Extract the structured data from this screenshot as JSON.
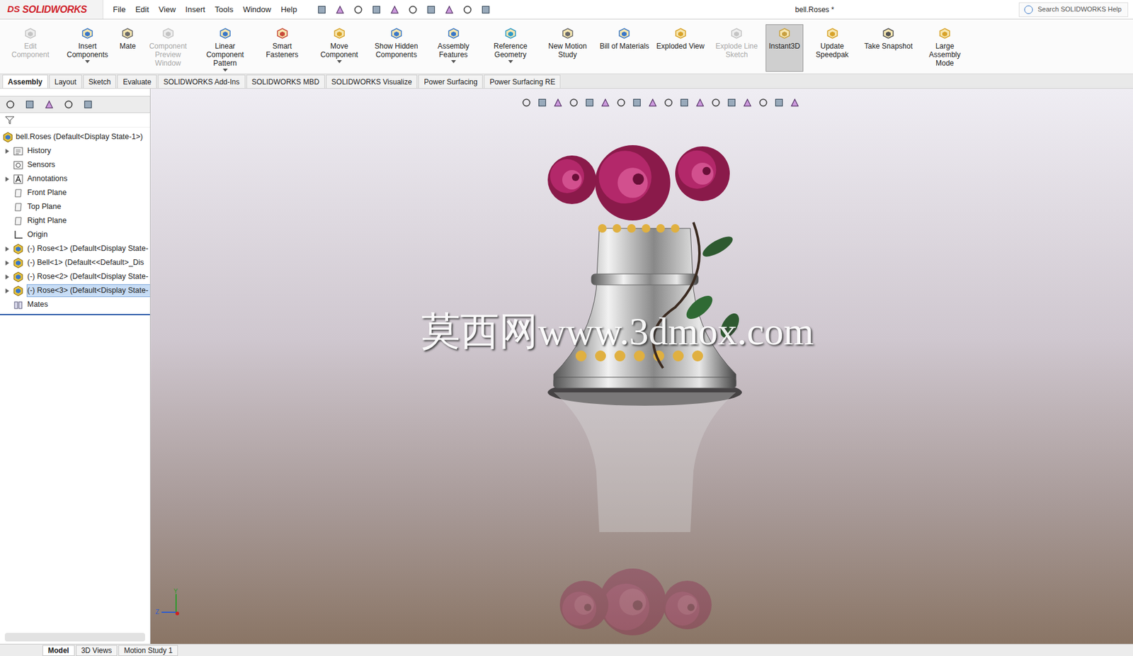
{
  "window": {
    "title": "bell.Roses *"
  },
  "app": {
    "logo_prefix": "DS",
    "logo": "SOLIDWORKS"
  },
  "menu": [
    "File",
    "Edit",
    "View",
    "Insert",
    "Tools",
    "Window",
    "Help"
  ],
  "search": {
    "placeholder": "Search SOLIDWORKS Help"
  },
  "ribbon": [
    {
      "label": "Edit Component",
      "disabled": true,
      "selected": false,
      "dropdown": false
    },
    {
      "label": "Insert Components",
      "disabled": false,
      "selected": false,
      "dropdown": true
    },
    {
      "label": "Mate",
      "disabled": false,
      "selected": false,
      "dropdown": false
    },
    {
      "label": "Component Preview Window",
      "disabled": true,
      "selected": false,
      "dropdown": false
    },
    {
      "label": "Linear Component Pattern",
      "disabled": false,
      "selected": false,
      "dropdown": true
    },
    {
      "label": "Smart Fasteners",
      "disabled": false,
      "selected": false,
      "dropdown": false
    },
    {
      "label": "Move Component",
      "disabled": false,
      "selected": false,
      "dropdown": true
    },
    {
      "label": "Show Hidden Components",
      "disabled": false,
      "selected": false,
      "dropdown": false
    },
    {
      "label": "Assembly Features",
      "disabled": false,
      "selected": false,
      "dropdown": true
    },
    {
      "label": "Reference Geometry",
      "disabled": false,
      "selected": false,
      "dropdown": true
    },
    {
      "label": "New Motion Study",
      "disabled": false,
      "selected": false,
      "dropdown": false
    },
    {
      "label": "Bill of Materials",
      "disabled": false,
      "selected": false,
      "dropdown": false
    },
    {
      "label": "Exploded View",
      "disabled": false,
      "selected": false,
      "dropdown": false
    },
    {
      "label": "Explode Line Sketch",
      "disabled": true,
      "selected": false,
      "dropdown": false
    },
    {
      "label": "Instant3D",
      "disabled": false,
      "selected": true,
      "dropdown": false
    },
    {
      "label": "Update Speedpak",
      "disabled": false,
      "selected": false,
      "dropdown": false
    },
    {
      "label": "Take Snapshot",
      "disabled": false,
      "selected": false,
      "dropdown": false
    },
    {
      "label": "Large Assembly Mode",
      "disabled": false,
      "selected": false,
      "dropdown": false
    }
  ],
  "tabs": [
    {
      "label": "Assembly",
      "selected": true
    },
    {
      "label": "Layout",
      "selected": false
    },
    {
      "label": "Sketch",
      "selected": false
    },
    {
      "label": "Evaluate",
      "selected": false
    },
    {
      "label": "SOLIDWORKS Add-Ins",
      "selected": false
    },
    {
      "label": "SOLIDWORKS MBD",
      "selected": false
    },
    {
      "label": "SOLIDWORKS Visualize",
      "selected": false
    },
    {
      "label": "Power Surfacing",
      "selected": false
    },
    {
      "label": "Power Surfacing RE",
      "selected": false
    }
  ],
  "tree": {
    "root": "bell.Roses  (Default<Display State-1>)",
    "items": [
      {
        "label": "History",
        "kind": "history",
        "expandable": true,
        "selected": false
      },
      {
        "label": "Sensors",
        "kind": "sensor",
        "expandable": false,
        "selected": false
      },
      {
        "label": "Annotations",
        "kind": "annotation",
        "expandable": true,
        "selected": false
      },
      {
        "label": "Front Plane",
        "kind": "plane",
        "expandable": false,
        "selected": false
      },
      {
        "label": "Top Plane",
        "kind": "plane",
        "expandable": false,
        "selected": false
      },
      {
        "label": "Right Plane",
        "kind": "plane",
        "expandable": false,
        "selected": false
      },
      {
        "label": "Origin",
        "kind": "origin",
        "expandable": false,
        "selected": false
      },
      {
        "label": "(-) Rose<1> (Default<Display State-",
        "kind": "component",
        "expandable": true,
        "selected": false
      },
      {
        "label": "(-) Bell<1> (Default<<Default>_Dis",
        "kind": "component",
        "expandable": true,
        "selected": false
      },
      {
        "label": "(-) Rose<2> (Default<Display State-",
        "kind": "component",
        "expandable": true,
        "selected": false
      },
      {
        "label": "(-) Rose<3> (Default<Display State-",
        "kind": "component",
        "expandable": true,
        "selected": true
      },
      {
        "label": "Mates",
        "kind": "mates",
        "expandable": false,
        "selected": false
      }
    ]
  },
  "bottom_tabs": [
    {
      "label": "Model",
      "selected": true
    },
    {
      "label": "3D Views",
      "selected": false
    },
    {
      "label": "Motion Study 1",
      "selected": false
    }
  ],
  "watermark": "莫西网www.3dmox.com",
  "triad": {
    "y": "Y",
    "z": "Z"
  }
}
